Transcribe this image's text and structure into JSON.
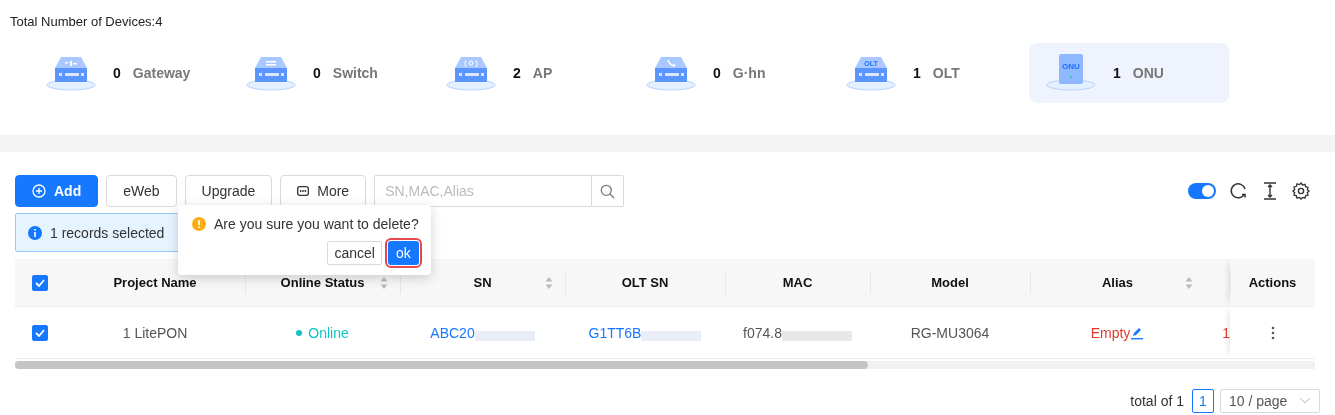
{
  "total_label": "Total Number of Devices:4",
  "device_types": [
    {
      "kind": "gateway",
      "count": "0",
      "label": "Gateway",
      "selected": false
    },
    {
      "kind": "switch",
      "count": "0",
      "label": "Switch",
      "selected": false
    },
    {
      "kind": "ap",
      "count": "2",
      "label": "AP",
      "selected": false
    },
    {
      "kind": "ghn",
      "count": "0",
      "label": "G·hn",
      "selected": false
    },
    {
      "kind": "olt",
      "count": "1",
      "label": "OLT",
      "selected": false,
      "badge": "OLT"
    },
    {
      "kind": "onu",
      "count": "1",
      "label": "ONU",
      "selected": true,
      "badge": "ONU"
    }
  ],
  "toolbar": {
    "buttons": [
      {
        "kind": "primary",
        "label": "Add"
      },
      {
        "kind": "plain",
        "label": "eWeb"
      },
      {
        "kind": "plain",
        "label": "Upgrade"
      },
      {
        "kind": "more",
        "label": "More"
      }
    ],
    "search": {
      "placeholder": "SN,MAC,Alias"
    },
    "toggle": {
      "on": true
    }
  },
  "selection_banner": {
    "text": "1 records selected"
  },
  "popconfirm": {
    "message": "Are you sure you want to delete?",
    "cancel": "cancel",
    "ok": "ok"
  },
  "table": {
    "all_checked": true,
    "columns": [
      {
        "label": "Project Name",
        "sortable": false
      },
      {
        "label": "Online Status",
        "sortable": true
      },
      {
        "label": "SN",
        "sortable": true
      },
      {
        "label": "OLT SN",
        "sortable": false
      },
      {
        "label": "MAC",
        "sortable": false
      },
      {
        "label": "Model",
        "sortable": false
      },
      {
        "label": "Alias",
        "sortable": true
      },
      {
        "label": "Actions",
        "sortable": false
      }
    ],
    "rows": [
      {
        "checked": true,
        "project": "1 LitePON",
        "status": {
          "text": "Online",
          "color": "#13c2c2"
        },
        "sn": "ABC20",
        "olt_sn": "G1TT6B",
        "mac": "f074.8",
        "model": "RG-MU3064",
        "alias": "Empty",
        "column_9": "1"
      }
    ]
  },
  "pagination": {
    "total": "total of 1",
    "pages": [
      {
        "label": "1",
        "selected": true
      }
    ],
    "page_size": "10 / page"
  }
}
